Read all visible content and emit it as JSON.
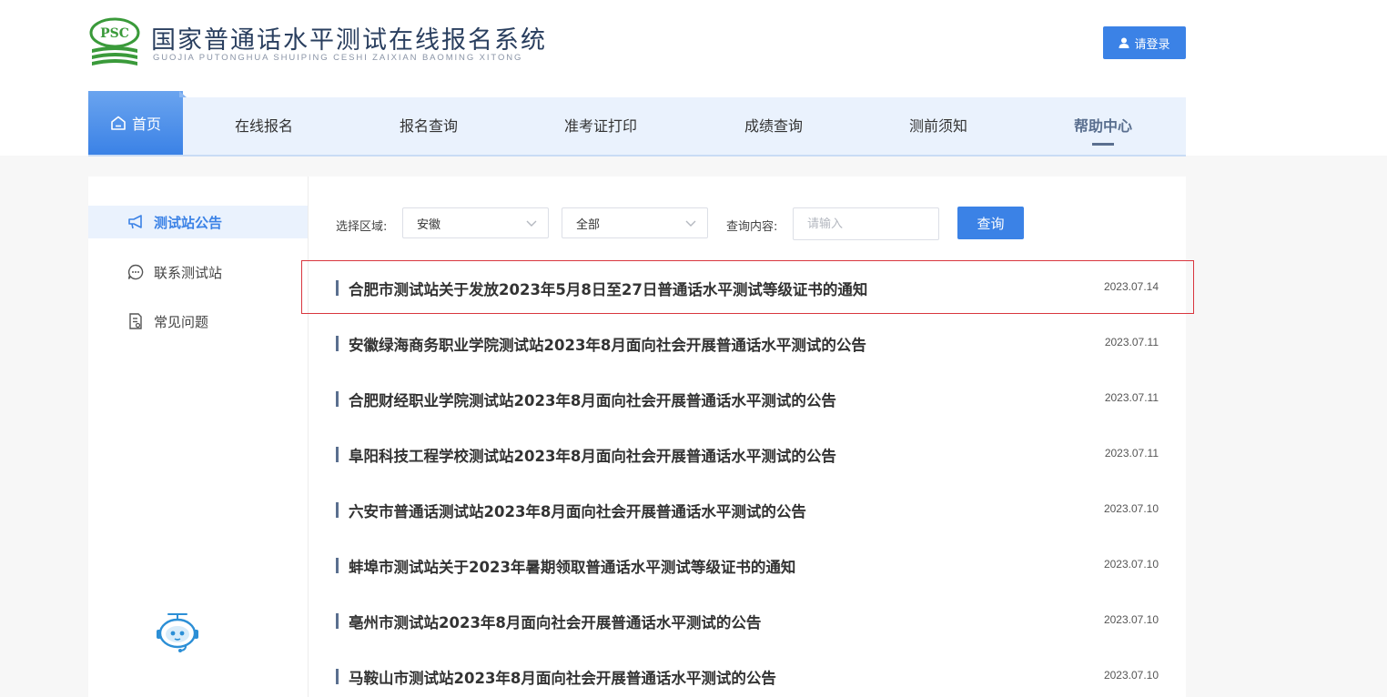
{
  "header": {
    "logo_text": "PSC",
    "title": "国家普通话水平测试在线报名系统",
    "subtitle": "GUOJIA PUTONGHUA SHUIPING CESHI ZAIXIAN BAOMING XITONG",
    "login_label": "请登录",
    "colors": {
      "accent": "#3b82e6",
      "logo_green": "#3a9a3a"
    }
  },
  "nav": {
    "home": "首页",
    "items": [
      "在线报名",
      "报名查询",
      "准考证打印",
      "成绩查询",
      "测前须知",
      "帮助中心"
    ],
    "active": "帮助中心"
  },
  "sidebar": {
    "items": [
      {
        "label": "测试站公告",
        "icon": "megaphone-icon"
      },
      {
        "label": "联系测试站",
        "icon": "chat-icon"
      },
      {
        "label": "常见问题",
        "icon": "document-icon"
      }
    ],
    "active": "测试站公告",
    "assistant_icon": "robot-assistant-icon"
  },
  "filters": {
    "region_label": "选择区域:",
    "region_value": "安徽",
    "scope_value": "全部",
    "query_label": "查询内容:",
    "query_placeholder": "请输入",
    "query_button": "查询"
  },
  "notices": [
    {
      "title": "合肥市测试站关于发放2023年5月8日至27日普通话水平测试等级证书的通知",
      "date": "2023.07.14"
    },
    {
      "title": "安徽绿海商务职业学院测试站2023年8月面向社会开展普通话水平测试的公告",
      "date": "2023.07.11"
    },
    {
      "title": "合肥财经职业学院测试站2023年8月面向社会开展普通话水平测试的公告",
      "date": "2023.07.11"
    },
    {
      "title": "阜阳科技工程学校测试站2023年8月面向社会开展普通话水平测试的公告",
      "date": "2023.07.11"
    },
    {
      "title": "六安市普通话测试站2023年8月面向社会开展普通话水平测试的公告",
      "date": "2023.07.10"
    },
    {
      "title": "蚌埠市测试站关于2023年暑期领取普通话水平测试等级证书的通知",
      "date": "2023.07.10"
    },
    {
      "title": "亳州市测试站2023年8月面向社会开展普通话水平测试的公告",
      "date": "2023.07.10"
    },
    {
      "title": "马鞍山市测试站2023年8月面向社会开展普通话水平测试的公告",
      "date": "2023.07.10"
    }
  ],
  "highlighted_notice_index": 0
}
